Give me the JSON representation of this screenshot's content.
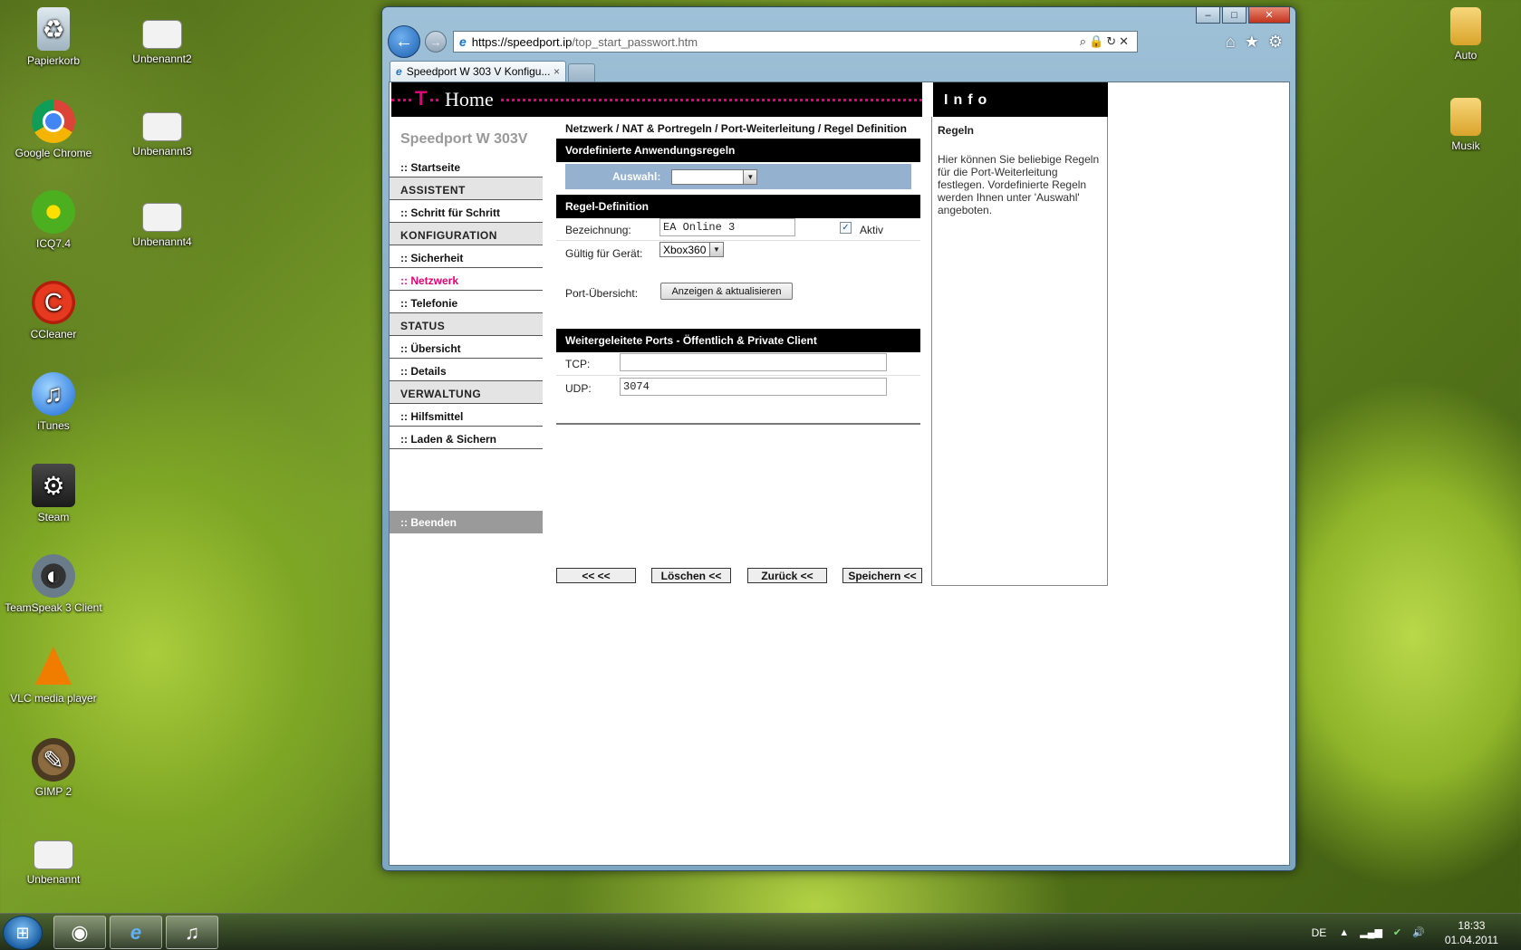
{
  "desktop": {
    "left_icons": [
      {
        "label": "Papierkorb",
        "icon": "recycle-bin-icon"
      },
      {
        "label": "Google Chrome",
        "icon": "chrome-icon"
      },
      {
        "label": "ICQ7.4",
        "icon": "icq-icon"
      },
      {
        "label": "CCleaner",
        "icon": "ccleaner-icon"
      },
      {
        "label": "iTunes",
        "icon": "itunes-icon"
      },
      {
        "label": "Steam",
        "icon": "steam-icon"
      },
      {
        "label": "TeamSpeak 3 Client",
        "icon": "teamspeak-icon"
      },
      {
        "label": "VLC media player",
        "icon": "vlc-icon"
      },
      {
        "label": "GIMP 2",
        "icon": "gimp-icon"
      },
      {
        "label": "Unbenannt",
        "icon": "document-icon"
      }
    ],
    "second_column": [
      {
        "label": "Unbenannt2",
        "icon": "document-icon"
      },
      {
        "label": "Unbenannt3",
        "icon": "document-icon"
      },
      {
        "label": "Unbenannt4",
        "icon": "document-icon"
      }
    ],
    "right_icons": [
      {
        "label": "Auto",
        "icon": "folder-icon"
      },
      {
        "label": "Musik",
        "icon": "folder-icon"
      }
    ]
  },
  "browser": {
    "url_host": "https://speedport.ip",
    "url_path": "/top_start_passwort.htm",
    "tab_title": "Speedport W 303 V Konfigu...",
    "tab_close": "×",
    "controls": {
      "minimize": "–",
      "maximize": "□",
      "close": "✕"
    }
  },
  "page": {
    "header_logo": "T",
    "header_title": "Home",
    "model": "Speedport W 303V",
    "menu": [
      {
        "label": ":: Startseite",
        "type": "item"
      },
      {
        "label": "ASSISTENT",
        "type": "section"
      },
      {
        "label": ":: Schritt für Schritt",
        "type": "item"
      },
      {
        "label": "KONFIGURATION",
        "type": "section"
      },
      {
        "label": ":: Sicherheit",
        "type": "item"
      },
      {
        "label": ":: Netzwerk",
        "type": "item",
        "active": true
      },
      {
        "label": ":: Telefonie",
        "type": "item"
      },
      {
        "label": "STATUS",
        "type": "section"
      },
      {
        "label": ":: Übersicht",
        "type": "item"
      },
      {
        "label": ":: Details",
        "type": "item"
      },
      {
        "label": "VERWALTUNG",
        "type": "section"
      },
      {
        "label": ":: Hilfsmittel",
        "type": "item"
      },
      {
        "label": ":: Laden & Sichern",
        "type": "item"
      }
    ],
    "beenden": ":: Beenden",
    "breadcrumb": "Netzwerk / NAT & Portregeln / Port-Weiterleitung / Regel Definition",
    "section_predefined": "Vordefinierte Anwendungsregeln",
    "auswahl_label": "Auswahl:",
    "auswahl_value": "",
    "section_rule": "Regel-Definition",
    "bezeichnung_label": "Bezeichnung:",
    "bezeichnung_value": "EA Online 3",
    "aktiv_label": "Aktiv",
    "aktiv_checked": true,
    "geraet_label": "Gültig für Gerät:",
    "geraet_value": "Xbox360",
    "port_overview_label": "Port-Übersicht:",
    "port_overview_button": "Anzeigen & aktualisieren",
    "section_ports": "Weitergeleitete Ports - Öffentlich & Private Client",
    "tcp_label": "TCP:",
    "tcp_value": "",
    "udp_label": "UDP:",
    "udp_value": "3074",
    "buttons": {
      "first": "<< <<",
      "delete": "Löschen <<",
      "back": "Zurück <<",
      "save": "Speichern <<"
    },
    "info": {
      "header": "Info",
      "title": "Regeln",
      "text": "Hier können Sie beliebige Regeln für die Port-Weiterleitung festlegen. Vordefinierte Regeln werden Ihnen unter 'Auswahl' angeboten."
    }
  },
  "taskbar": {
    "language": "DE",
    "time": "18:33",
    "date": "01.04.2011"
  }
}
